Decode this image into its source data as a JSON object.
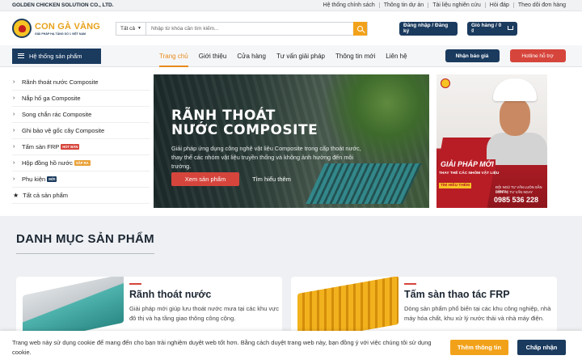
{
  "topbar": {
    "company": "GOLDEN CHICKEN SOLUTION CO., LTD.",
    "links": [
      "Hệ thống chính sách",
      "Thông tin dự án",
      "Tài liệu nghiên cứu",
      "Hỏi đáp",
      "Theo dõi đơn hàng"
    ]
  },
  "logo": {
    "name": "CON GÀ VÀNG",
    "tagline": "GIẢI PHÁP HẠ TẦNG SỐ 1 VIỆT NAM"
  },
  "search": {
    "category": "Tất cả",
    "placeholder": "Nhập từ khóa cần tìm kiếm..."
  },
  "header": {
    "login_label": "Đăng nhập / Đăng ký",
    "cart_label": "Giỏ hàng / 0 ₫"
  },
  "nav": {
    "categories_label": "Hệ thống sản phẩm",
    "items": [
      "Trang chủ",
      "Giới thiệu",
      "Cửa hàng",
      "Tư vấn giải pháp",
      "Thông tin mới",
      "Liên hệ"
    ],
    "active_index": 0,
    "quote_label": "Nhận báo giá",
    "hotline_label": "Hotline hỗ trợ"
  },
  "sidebar": {
    "items": [
      {
        "label": "Rãnh thoát nước Composite",
        "badge": ""
      },
      {
        "label": "Nắp hố ga Composite",
        "badge": ""
      },
      {
        "label": "Song chắn rác Composite",
        "badge": ""
      },
      {
        "label": "Ghi bảo vệ gốc cây Composite",
        "badge": ""
      },
      {
        "label": "Tấm sàn FRP",
        "badge": "HOT BÁN"
      },
      {
        "label": "Hộp đồng hồ nước",
        "badge": "SẮP RA"
      },
      {
        "label": "Phụ kiện",
        "badge": "MỚI"
      }
    ],
    "all_label": "Tất cả sản phẩm"
  },
  "hero": {
    "title": "RÃNH THOÁT NƯỚC COMPOSITE",
    "description": "Giải pháp ứng dụng công nghệ vật liệu Composite trong cấp thoát nước, thay thế các nhóm vật liệu truyền thống và không ảnh hưởng đến môi trường.",
    "cta_label": "Xem sản phẩm",
    "learn_label": "Tìm hiểu thêm"
  },
  "promo": {
    "headline": "GIẢI PHÁP MỚI",
    "subline": "THAY THẾ CÁC NHÓM VẬT LIỆU",
    "learn": "TÌM HIỂU THÊM",
    "team": "ĐỘI NGŨ TƯ VẤN LUÔN SẴN SÀNG!",
    "contact_label": "LIÊN HỆ TƯ VẤN NGAY",
    "phone": "0985 536 228"
  },
  "section": {
    "title": "DANH MỤC SẢN PHẨM",
    "cards": [
      {
        "title": "Rãnh thoát nước",
        "description": "Giải pháp mới giúp lưu thoát nước mưa tại các khu vực đô thị và hạ tầng giao thông công cộng."
      },
      {
        "title": "Tấm sàn thao tác FRP",
        "description": "Dòng sản phẩm phổ biến tại các khu công nghiệp, nhà máy hóa chất, khu xử lý nước thải và nhà máy điện."
      }
    ]
  },
  "cookie": {
    "message": "Trang web này sử dụng cookie để mang đến cho bạn trải nghiệm duyệt web tốt hơn. Bằng cách duyệt trang web này, bạn đồng ý với việc chúng tôi sử dụng cookie.",
    "more_label": "Thêm thông tin",
    "accept_label": "Chấp nhận"
  },
  "colors": {
    "brand_navy": "#1a3a5e",
    "brand_orange": "#f2a21a",
    "accent_red": "#d6453c",
    "active_nav": "#e88a1a"
  }
}
